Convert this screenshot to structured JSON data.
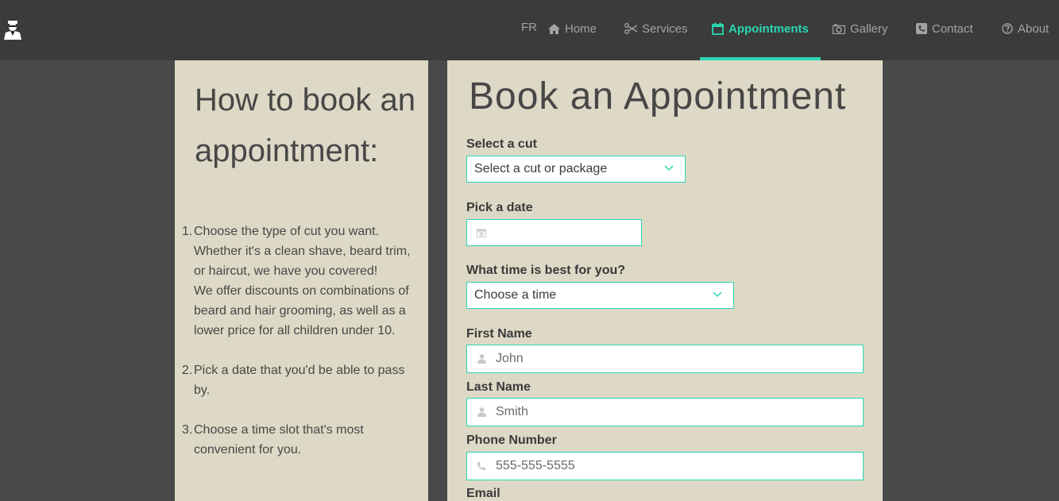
{
  "nav": {
    "lang": "FR",
    "items": [
      {
        "label": "Home",
        "icon": "home-icon"
      },
      {
        "label": "Services",
        "icon": "scissors-icon"
      },
      {
        "label": "Appointments",
        "icon": "calendar-icon",
        "active": true
      },
      {
        "label": "Gallery",
        "icon": "camera-icon"
      },
      {
        "label": "Contact",
        "icon": "phone-icon"
      },
      {
        "label": "About",
        "icon": "question-circle-icon"
      }
    ],
    "accent_color": "#2ad7b2"
  },
  "guide": {
    "title": "How to book an appointment:",
    "steps": [
      {
        "num": "1.",
        "text": "Choose the type of cut you want. Whether it's a clean shave, beard trim, or haircut, we have you covered!",
        "extra": "We offer discounts on combinations of beard and hair grooming, as well as a lower price for all children under 10."
      },
      {
        "num": "2.",
        "text": "Pick a date that you'd be able to pass by."
      },
      {
        "num": "3.",
        "text": "Choose a time slot that's most convenient for you."
      }
    ]
  },
  "form": {
    "title": "Book an Appointment",
    "cut_label": "Select a cut",
    "cut_value": "Select a cut or package",
    "date_label": "Pick a date",
    "date_value": "",
    "time_label": "What time is best for you?",
    "time_value": "Choose a time",
    "first_name_label": "First Name",
    "first_name_placeholder": "John",
    "last_name_label": "Last Name",
    "last_name_placeholder": "Smith",
    "phone_label": "Phone Number",
    "phone_placeholder": "555-555-5555",
    "email_label": "Email"
  }
}
